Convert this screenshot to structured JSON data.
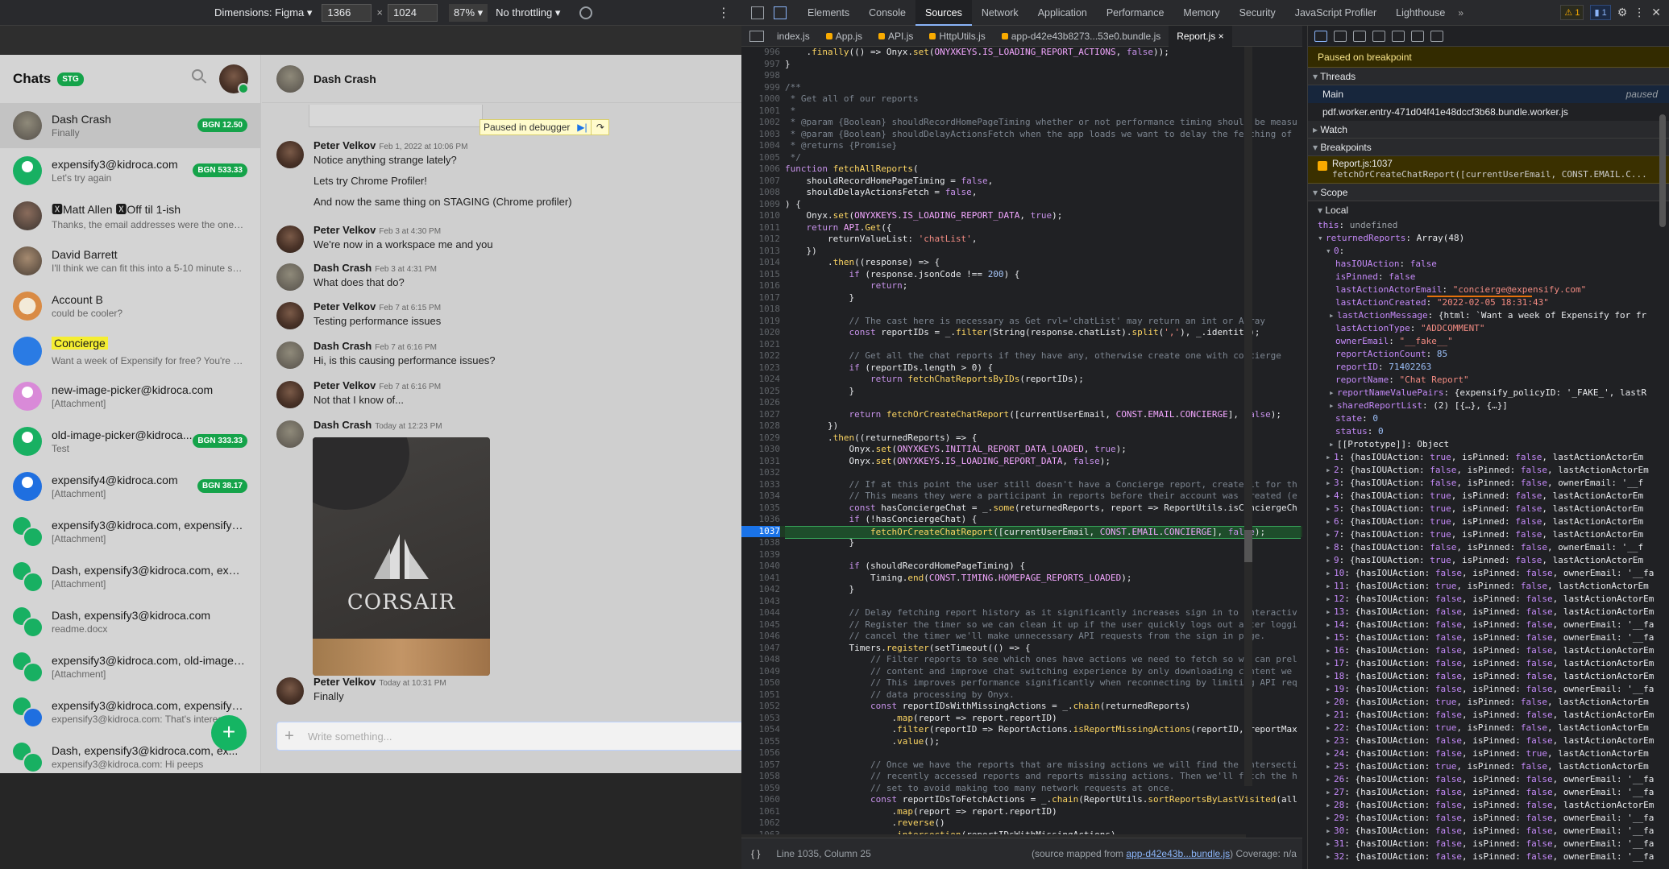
{
  "emulation": {
    "dimensions_label": "Dimensions: Figma ▾",
    "width": "1366",
    "height": "1024",
    "zoom": "87% ▾",
    "throttling": "No throttling ▾"
  },
  "app": {
    "sidebar_title": "Chats",
    "env_badge": "STG",
    "chats": [
      {
        "name": "Dash Crash",
        "sub": "Finally",
        "badge": "BGN 12.50",
        "avatar": "photo1",
        "active": true
      },
      {
        "name": "expensify3@kidroca.com",
        "sub": "Let's try again",
        "badge": "BGN 533.33",
        "avatar": "g"
      },
      {
        "name": "🆇Matt Allen 🆇Off til 1-ish",
        "sub": "Thanks, the email addresses were the one ite...",
        "avatar": "photo2"
      },
      {
        "name": "David Barrett",
        "sub": "I'll think we can fit this into a 5-10 minute ses...",
        "avatar": "photo3"
      },
      {
        "name": "Account B",
        "sub": "could be cooler?",
        "avatar": "fox"
      },
      {
        "name": "Concierge",
        "sub": "Want a week of Expensify for free? You're alm...",
        "avatar": "cons",
        "highlight": true
      },
      {
        "name": "new-image-picker@kidroca.com",
        "sub": "[Attachment]",
        "avatar": "p"
      },
      {
        "name": "old-image-picker@kidroca....",
        "sub": "Test",
        "badge": "BGN 333.33",
        "avatar": "g"
      },
      {
        "name": "expensify4@kidroca.com",
        "sub": "[Attachment]",
        "badge": "BGN 38.17",
        "avatar": "b"
      },
      {
        "name": "expensify3@kidroca.com, expensify5@...",
        "sub": "[Attachment]",
        "avatar": "multi"
      },
      {
        "name": "Dash, expensify3@kidroca.com, expen...",
        "sub": "[Attachment]",
        "avatar": "multi"
      },
      {
        "name": "Dash, expensify3@kidroca.com",
        "sub": "readme.docx",
        "avatar": "multi"
      },
      {
        "name": "expensify3@kidroca.com, old-image-pi...",
        "sub": "[Attachment]",
        "avatar": "multi"
      },
      {
        "name": "expensify3@kidroca.com, expensify4@...",
        "sub": "expensify3@kidroca.com: That's interesting",
        "avatar": "multi mb"
      },
      {
        "name": "Dash, expensify3@kidroca.com, ex...",
        "sub": "expensify3@kidroca.com: Hi peeps",
        "avatar": "multi"
      }
    ],
    "fab": "+",
    "chat_title": "Dash Crash",
    "debugger_pill": "Paused in debugger",
    "messages": [
      {
        "who": "Peter Velkov",
        "when": "Feb 1, 2022 at 10:06 PM",
        "text": "Notice anything strange lately?",
        "extra": [
          "Lets try Chrome Profiler!",
          "And now the same thing on STAGING (Chrome profiler)"
        ],
        "av": "pv"
      },
      {
        "who": "Peter Velkov",
        "when": "Feb 3 at 4:30 PM",
        "text": "We're now in a workspace me and you",
        "av": "pv"
      },
      {
        "who": "Dash Crash",
        "when": "Feb 3 at 4:31 PM",
        "text": "What does that do?",
        "av": "dc"
      },
      {
        "who": "Peter Velkov",
        "when": "Feb 7 at 6:15 PM",
        "text": "Testing performance issues",
        "av": "pv"
      },
      {
        "who": "Dash Crash",
        "when": "Feb 7 at 6:16 PM",
        "text": "Hi, is this causing performance issues?",
        "av": "dc"
      },
      {
        "who": "Peter Velkov",
        "when": "Feb 7 at 6:16 PM",
        "text": "Not that I know of...",
        "av": "pv"
      },
      {
        "who": "Dash Crash",
        "when": "Today at 12:23 PM",
        "text": "",
        "av": "dc"
      },
      {
        "who": "Peter Velkov",
        "when": "Today at 10:31 PM",
        "text": "Finally",
        "av": "pv"
      }
    ],
    "photo_brand": "CORSAIR",
    "composer_placeholder": "Write something..."
  },
  "devtools": {
    "tabs": [
      "Elements",
      "Console",
      "Sources",
      "Network",
      "Application",
      "Performance",
      "Memory",
      "Security",
      "JavaScript Profiler",
      "Lighthouse"
    ],
    "active_tab": "Sources",
    "warnings": "⚠ 1",
    "infos": "▮ 1",
    "file_tabs": [
      "index.js",
      "App.js",
      "API.js",
      "HttpUtils.js",
      "app-d42e43b8273...53e0.bundle.js",
      "Report.js ×"
    ],
    "status": {
      "braces": "{ }",
      "position": "Line 1035, Column 25",
      "source": "(source mapped from ",
      "source_link": "app-d42e43b...bundle.js",
      "coverage": ") Coverage: n/a"
    },
    "paused": "Paused on breakpoint",
    "threads_label": "Threads",
    "thread_main": "Main",
    "thread_main_state": "paused",
    "thread_worker": "pdf.worker.entry-471d04f41e48dccf3b68.bundle.worker.js",
    "watch_label": "Watch",
    "breakpoints_label": "Breakpoints",
    "bp_file": "Report.js:1037",
    "bp_code": "fetchOrCreateChatReport([currentUserEmail, CONST.EMAIL.C...",
    "scope_label": "Scope",
    "local_label": "Local"
  }
}
